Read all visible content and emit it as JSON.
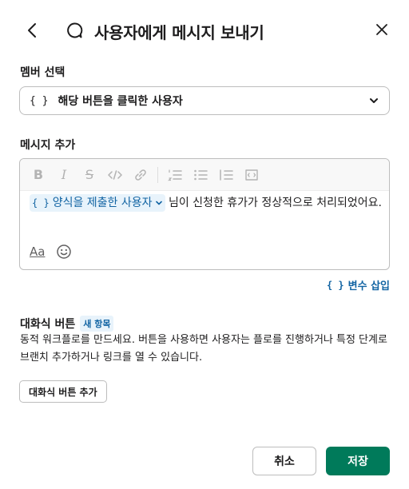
{
  "header": {
    "title": "사용자에게 메시지 보내기",
    "back_icon": "chevron-left-icon",
    "title_icon": "message-bubble-icon",
    "close_icon": "close-icon"
  },
  "member_select": {
    "label": "멤버 선택",
    "braces": "{ }",
    "value": "해당 버튼을 클릭한 사용자",
    "chevron_icon": "chevron-down-icon"
  },
  "message": {
    "label": "메시지 추가",
    "toolbar": [
      "bold-icon",
      "italic-icon",
      "strikethrough-icon",
      "code-icon",
      "link-icon",
      "ordered-list-icon",
      "bulleted-list-icon",
      "quote-icon",
      "code-block-icon"
    ],
    "chip_braces": "{ }",
    "chip_text": "양식을 제출한 사용자",
    "body_text": "님이 신청한 휴가가 정상적으로 처리되었어요.",
    "format_label": "Aa",
    "emoji_icon": "smile-icon"
  },
  "insert_variable": {
    "braces": "{ }",
    "label": "변수 삽입"
  },
  "interactive_buttons": {
    "title": "대화식 버튼",
    "badge": "새 항목",
    "description": "동적 워크플로를 만드세요. 버튼을 사용하면 사용자는 플로를 진행하거나 특정 단계로 브랜치 추가하거나 링크를 열 수 있습니다.",
    "add_button": "대화식 버튼 추가"
  },
  "footer": {
    "cancel": "취소",
    "save": "저장"
  },
  "colors": {
    "accent_link": "#1264a3",
    "save_green": "#007a5a",
    "chip_bg": "#e8f3fb"
  }
}
